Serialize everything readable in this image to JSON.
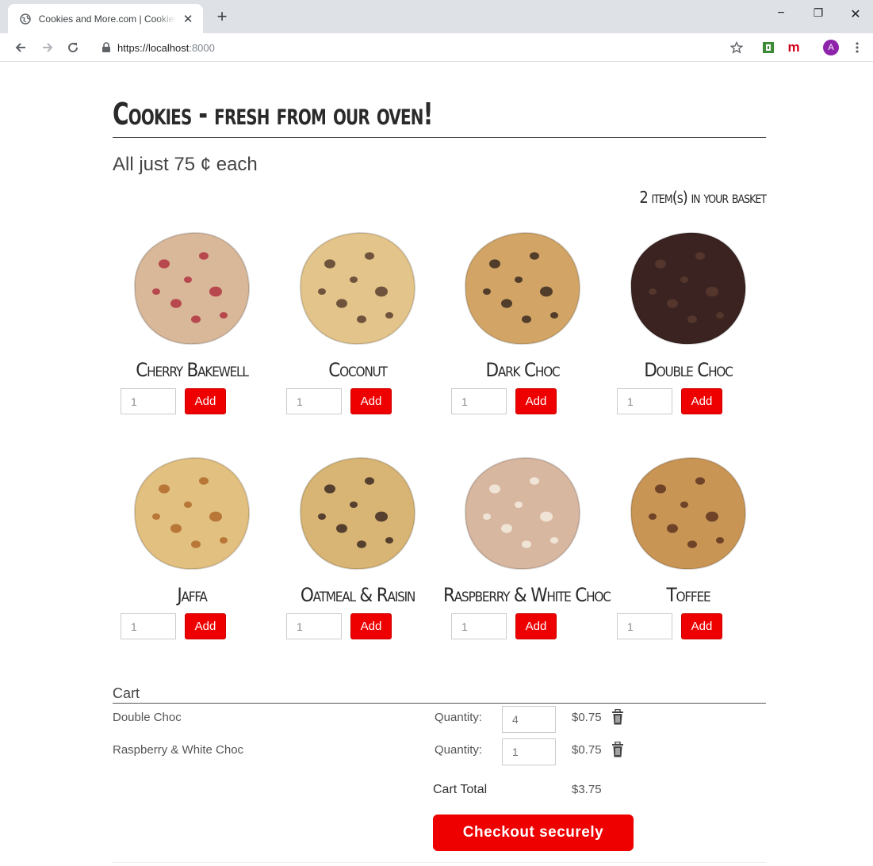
{
  "browser": {
    "tab_title": "Cookies and More.com | Cookies - fresh from our oven!",
    "new_tab": "+",
    "minimize": "−",
    "restore": "❐",
    "close": "✕",
    "url_host": "https://localhost",
    "url_port": ":8000",
    "profile_initial": "A",
    "extension_m": "m"
  },
  "page": {
    "title": "Cookies - fresh from our oven!",
    "subtitle": "All just 75 ¢  each",
    "basket_status": "2 item(s) in your basket"
  },
  "products": [
    {
      "name": "Cherry Bakewell",
      "qty": "1",
      "add_label": "Add",
      "color": "#d9b89a",
      "spot": "#b0343f"
    },
    {
      "name": "Coconut",
      "qty": "1",
      "add_label": "Add",
      "color": "#e3c48a",
      "spot": "#5a3f2e"
    },
    {
      "name": "Dark Choc",
      "qty": "1",
      "add_label": "Add",
      "color": "#d2a566",
      "spot": "#3b2a20"
    },
    {
      "name": "Double Choc",
      "qty": "1",
      "add_label": "Add",
      "color": "#3a2320",
      "spot": "#5a3a30"
    },
    {
      "name": "Jaffa",
      "qty": "1",
      "add_label": "Add",
      "color": "#e2c080",
      "spot": "#b06a2a"
    },
    {
      "name": "Oatmeal & Raisin",
      "qty": "1",
      "add_label": "Add",
      "color": "#d8b574",
      "spot": "#3e2a22"
    },
    {
      "name": "Raspberry & White Choc",
      "qty": "1",
      "add_label": "Add",
      "color": "#d8b7a0",
      "spot": "#f4ece0"
    },
    {
      "name": "Toffee",
      "qty": "1",
      "add_label": "Add",
      "color": "#c99555",
      "spot": "#5e3520"
    }
  ],
  "cart": {
    "heading": "Cart",
    "items": [
      {
        "name": "Double Choc",
        "qty_label": "Quantity:",
        "qty": "4",
        "price": "$0.75"
      },
      {
        "name": "Raspberry & White Choc",
        "qty_label": "Quantity:",
        "qty": "1",
        "price": "$0.75"
      }
    ],
    "total_label": "Cart Total",
    "total_value": "$3.75",
    "checkout_label": "Checkout securely"
  },
  "colors": {
    "accent": "#ee0000"
  }
}
